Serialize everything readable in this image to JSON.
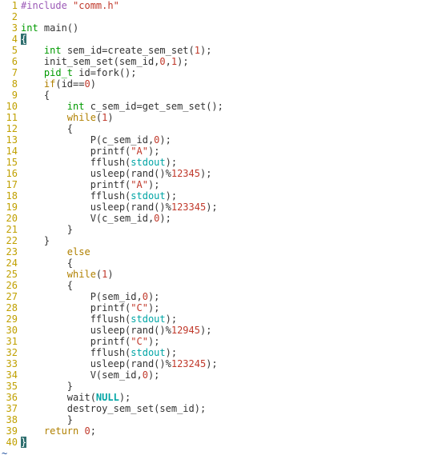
{
  "language": "c",
  "colorscheme": "light",
  "cursor": {
    "line": 4,
    "col": 1,
    "char": "{"
  },
  "lines": [
    {
      "n": 1,
      "tokens": [
        {
          "c": "tok-pp",
          "t": "#include "
        },
        {
          "c": "tok-inc",
          "t": "\"comm.h\""
        }
      ]
    },
    {
      "n": 2,
      "tokens": []
    },
    {
      "n": 3,
      "tokens": [
        {
          "c": "tok-type",
          "t": "int"
        },
        {
          "c": "",
          "t": " main()"
        }
      ]
    },
    {
      "n": 4,
      "tokens": [
        {
          "cursor": true,
          "t": "{"
        }
      ]
    },
    {
      "n": 5,
      "tokens": [
        {
          "c": "",
          "t": "    "
        },
        {
          "c": "tok-type",
          "t": "int"
        },
        {
          "c": "",
          "t": " sem_id=create_sem_set("
        },
        {
          "c": "tok-num",
          "t": "1"
        },
        {
          "c": "",
          "t": ");"
        }
      ]
    },
    {
      "n": 6,
      "tokens": [
        {
          "c": "",
          "t": "    init_sem_set(sem_id,"
        },
        {
          "c": "tok-num",
          "t": "0"
        },
        {
          "c": "",
          "t": ","
        },
        {
          "c": "tok-num",
          "t": "1"
        },
        {
          "c": "",
          "t": ");"
        }
      ]
    },
    {
      "n": 7,
      "tokens": [
        {
          "c": "",
          "t": "    "
        },
        {
          "c": "tok-type",
          "t": "pid_t"
        },
        {
          "c": "",
          "t": " id=fork();"
        }
      ]
    },
    {
      "n": 8,
      "tokens": [
        {
          "c": "",
          "t": "    "
        },
        {
          "c": "tok-kw",
          "t": "if"
        },
        {
          "c": "",
          "t": "(id=="
        },
        {
          "c": "tok-num",
          "t": "0"
        },
        {
          "c": "",
          "t": ")"
        }
      ]
    },
    {
      "n": 9,
      "tokens": [
        {
          "c": "",
          "t": "    {"
        }
      ]
    },
    {
      "n": 10,
      "tokens": [
        {
          "c": "",
          "t": "        "
        },
        {
          "c": "tok-type",
          "t": "int"
        },
        {
          "c": "",
          "t": " c_sem_id=get_sem_set();"
        }
      ]
    },
    {
      "n": 11,
      "tokens": [
        {
          "c": "",
          "t": "        "
        },
        {
          "c": "tok-kw",
          "t": "while"
        },
        {
          "c": "",
          "t": "("
        },
        {
          "c": "tok-num",
          "t": "1"
        },
        {
          "c": "",
          "t": ")"
        }
      ]
    },
    {
      "n": 12,
      "tokens": [
        {
          "c": "",
          "t": "        {"
        }
      ]
    },
    {
      "n": 13,
      "tokens": [
        {
          "c": "",
          "t": "            P(c_sem_id,"
        },
        {
          "c": "tok-num",
          "t": "0"
        },
        {
          "c": "",
          "t": ");"
        }
      ]
    },
    {
      "n": 14,
      "tokens": [
        {
          "c": "",
          "t": "            printf("
        },
        {
          "c": "tok-str",
          "t": "\"A\""
        },
        {
          "c": "",
          "t": ");"
        }
      ]
    },
    {
      "n": 15,
      "tokens": [
        {
          "c": "",
          "t": "            fflush("
        },
        {
          "c": "tok-ident",
          "t": "stdout"
        },
        {
          "c": "",
          "t": ");"
        }
      ]
    },
    {
      "n": 16,
      "tokens": [
        {
          "c": "",
          "t": "            usleep(rand()%"
        },
        {
          "c": "tok-num",
          "t": "12345"
        },
        {
          "c": "",
          "t": ");"
        }
      ]
    },
    {
      "n": 17,
      "tokens": [
        {
          "c": "",
          "t": "            printf("
        },
        {
          "c": "tok-str",
          "t": "\"A\""
        },
        {
          "c": "",
          "t": ");"
        }
      ]
    },
    {
      "n": 18,
      "tokens": [
        {
          "c": "",
          "t": "            fflush("
        },
        {
          "c": "tok-ident",
          "t": "stdout"
        },
        {
          "c": "",
          "t": ");"
        }
      ]
    },
    {
      "n": 19,
      "tokens": [
        {
          "c": "",
          "t": "            usleep(rand()%"
        },
        {
          "c": "tok-num",
          "t": "123345"
        },
        {
          "c": "",
          "t": ");"
        }
      ]
    },
    {
      "n": 20,
      "tokens": [
        {
          "c": "",
          "t": "            V(c_sem_id,"
        },
        {
          "c": "tok-num",
          "t": "0"
        },
        {
          "c": "",
          "t": ");"
        }
      ]
    },
    {
      "n": 21,
      "tokens": [
        {
          "c": "",
          "t": "        }"
        }
      ]
    },
    {
      "n": 22,
      "tokens": [
        {
          "c": "",
          "t": "    }"
        }
      ]
    },
    {
      "n": 23,
      "tokens": [
        {
          "c": "",
          "t": "        "
        },
        {
          "c": "tok-kw",
          "t": "else"
        }
      ]
    },
    {
      "n": 24,
      "tokens": [
        {
          "c": "",
          "t": "        {"
        }
      ]
    },
    {
      "n": 25,
      "tokens": [
        {
          "c": "",
          "t": "        "
        },
        {
          "c": "tok-kw",
          "t": "while"
        },
        {
          "c": "",
          "t": "("
        },
        {
          "c": "tok-num",
          "t": "1"
        },
        {
          "c": "",
          "t": ")"
        }
      ]
    },
    {
      "n": 26,
      "tokens": [
        {
          "c": "",
          "t": "        {"
        }
      ]
    },
    {
      "n": 27,
      "tokens": [
        {
          "c": "",
          "t": "            P(sem_id,"
        },
        {
          "c": "tok-num",
          "t": "0"
        },
        {
          "c": "",
          "t": ");"
        }
      ]
    },
    {
      "n": 28,
      "tokens": [
        {
          "c": "",
          "t": "            printf("
        },
        {
          "c": "tok-str",
          "t": "\"C\""
        },
        {
          "c": "",
          "t": ");"
        }
      ]
    },
    {
      "n": 29,
      "tokens": [
        {
          "c": "",
          "t": "            fflush("
        },
        {
          "c": "tok-ident",
          "t": "stdout"
        },
        {
          "c": "",
          "t": ");"
        }
      ]
    },
    {
      "n": 30,
      "tokens": [
        {
          "c": "",
          "t": "            usleep(rand()%"
        },
        {
          "c": "tok-num",
          "t": "12945"
        },
        {
          "c": "",
          "t": ");"
        }
      ]
    },
    {
      "n": 31,
      "tokens": [
        {
          "c": "",
          "t": "            printf("
        },
        {
          "c": "tok-str",
          "t": "\"C\""
        },
        {
          "c": "",
          "t": ");"
        }
      ]
    },
    {
      "n": 32,
      "tokens": [
        {
          "c": "",
          "t": "            fflush("
        },
        {
          "c": "tok-ident",
          "t": "stdout"
        },
        {
          "c": "",
          "t": ");"
        }
      ]
    },
    {
      "n": 33,
      "tokens": [
        {
          "c": "",
          "t": "            usleep(rand()%"
        },
        {
          "c": "tok-num",
          "t": "123245"
        },
        {
          "c": "",
          "t": ");"
        }
      ]
    },
    {
      "n": 34,
      "tokens": [
        {
          "c": "",
          "t": "            V(sem_id,"
        },
        {
          "c": "tok-num",
          "t": "0"
        },
        {
          "c": "",
          "t": ");"
        }
      ]
    },
    {
      "n": 35,
      "tokens": [
        {
          "c": "",
          "t": "        }"
        }
      ]
    },
    {
      "n": 36,
      "tokens": [
        {
          "c": "",
          "t": "        wait("
        },
        {
          "c": "tok-macro",
          "t": "NULL"
        },
        {
          "c": "",
          "t": ");"
        }
      ]
    },
    {
      "n": 37,
      "tokens": [
        {
          "c": "",
          "t": "        destroy_sem_set(sem_id);"
        }
      ]
    },
    {
      "n": 38,
      "tokens": [
        {
          "c": "",
          "t": "        }"
        }
      ]
    },
    {
      "n": 39,
      "tokens": [
        {
          "c": "",
          "t": "    "
        },
        {
          "c": "tok-kw",
          "t": "return"
        },
        {
          "c": "",
          "t": " "
        },
        {
          "c": "tok-num",
          "t": "0"
        },
        {
          "c": "",
          "t": ";"
        }
      ]
    },
    {
      "n": 40,
      "tokens": [
        {
          "cursor": true,
          "t": "}"
        }
      ]
    }
  ],
  "eof_marker": "~"
}
